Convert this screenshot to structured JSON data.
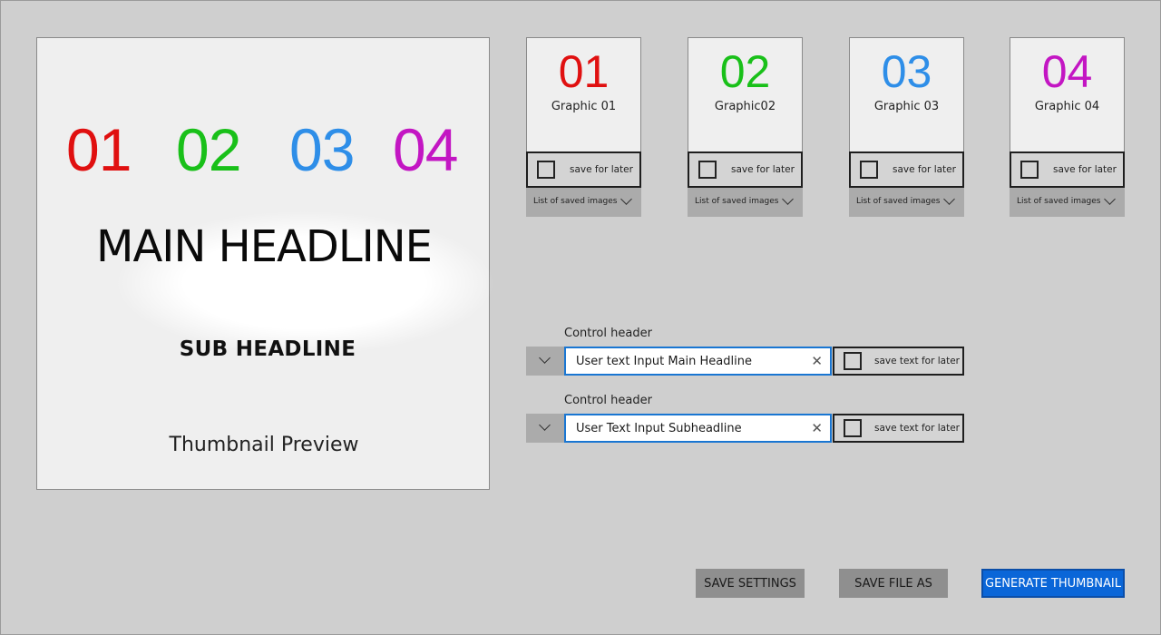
{
  "preview": {
    "numbers": [
      {
        "label": "01",
        "color": "#e01010"
      },
      {
        "label": "02",
        "color": "#19c019"
      },
      {
        "label": "03",
        "color": "#2e8ee8"
      },
      {
        "label": "04",
        "color": "#c316c3"
      }
    ],
    "main_headline": "MAIN HEADLINE",
    "sub_headline": "SUB HEADLINE",
    "caption": "Thumbnail Preview"
  },
  "tiles": [
    {
      "number": "01",
      "color": "#e01010",
      "name": "Graphic 01",
      "save_label": "save for later",
      "dropdown_label": "List of saved images"
    },
    {
      "number": "02",
      "color": "#19c019",
      "name": "Graphic02",
      "save_label": "save for later",
      "dropdown_label": "List of saved images"
    },
    {
      "number": "03",
      "color": "#2e8ee8",
      "name": "Graphic 03",
      "save_label": "save for later",
      "dropdown_label": "List of saved images"
    },
    {
      "number": "04",
      "color": "#c316c3",
      "name": "Graphic 04",
      "save_label": "save for later",
      "dropdown_label": "List of saved images"
    }
  ],
  "inputs": [
    {
      "header": "Control header",
      "value": "User text Input Main Headline",
      "save_label": "save text for later"
    },
    {
      "header": "Control header",
      "value": "User Text Input Subheadline",
      "save_label": "save text for later"
    }
  ],
  "buttons": {
    "save_settings": "SAVE SETTINGS",
    "save_file_as": "SAVE FILE AS",
    "generate": "GENERATE THUMBNAIL"
  },
  "icons": {
    "clear": "close-icon",
    "dropdown": "chevron-down-icon",
    "checkbox": "checkbox"
  },
  "colors": {
    "accent": "#0a66d8",
    "background": "#cfcfcf"
  }
}
